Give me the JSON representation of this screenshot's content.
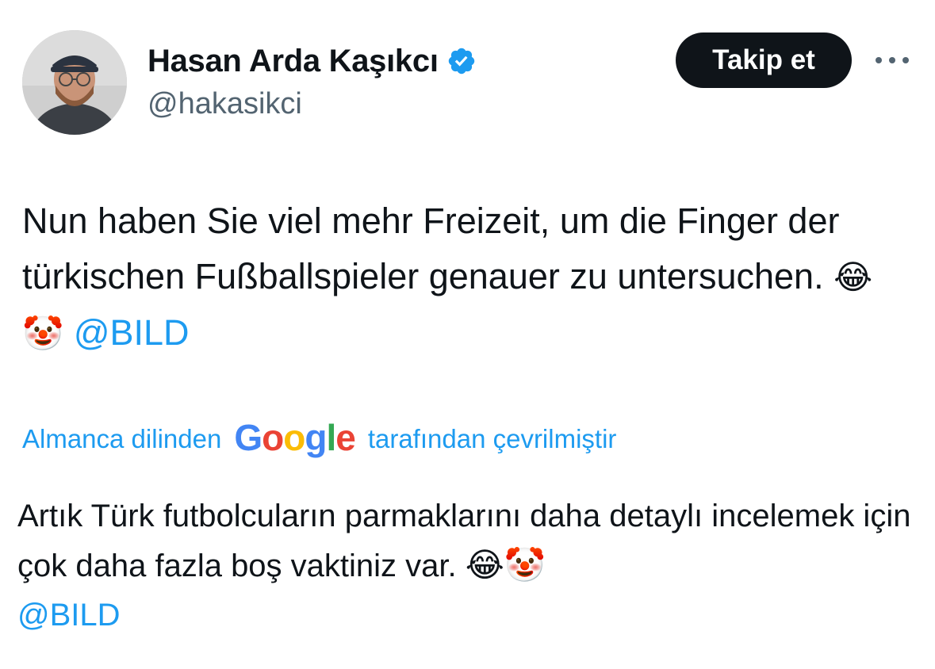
{
  "author": {
    "display_name": "Hasan Arda Kaşıkcı",
    "handle": "@hakasikci",
    "verified": true
  },
  "actions": {
    "follow_label": "Takip et",
    "more_icon": "more-horizontal-icon"
  },
  "tweet": {
    "text_main": "Nun haben Sie viel mehr Freizeit, um die Finger der türkischen Fußballspieler genauer zu untersuchen.",
    "emojis": "😂🤡",
    "mention": "@BILD"
  },
  "translation_notice": {
    "prefix": "Almanca dilinden",
    "google_letters": [
      "G",
      "o",
      "o",
      "g",
      "l",
      "e"
    ],
    "suffix": "tarafından çevrilmiştir"
  },
  "translation": {
    "text_main": "Artık Türk futbolcuların parmaklarını daha detaylı incelemek için çok daha fazla boş vaktiniz var.",
    "emojis": "😂🤡",
    "mention": "@BILD"
  },
  "colors": {
    "accent": "#1d9bf0",
    "text": "#0f1419",
    "secondary": "#536471",
    "follow_bg": "#0f1419"
  }
}
